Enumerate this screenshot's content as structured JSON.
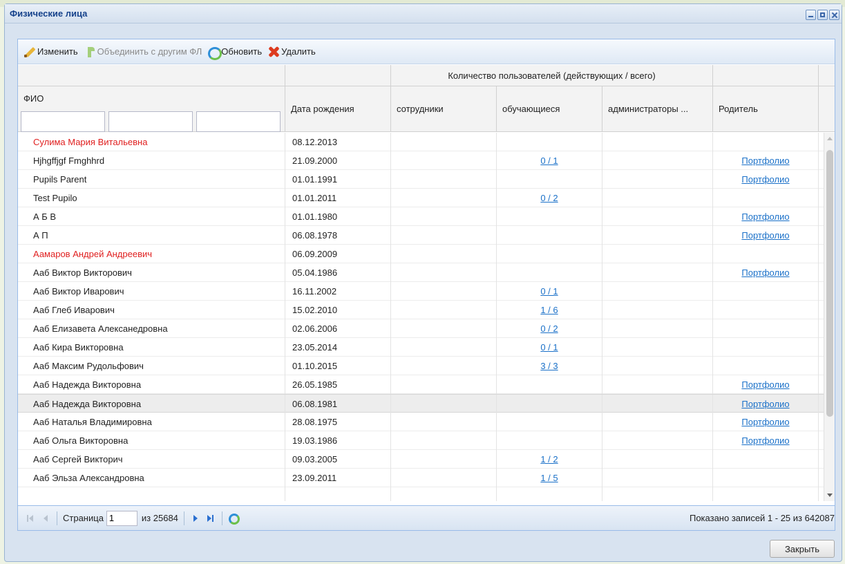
{
  "window": {
    "title": "Физические лица"
  },
  "toolbar": {
    "edit": "Изменить",
    "merge": "Объединить с другим ФЛ",
    "refresh": "Обновить",
    "delete": "Удалить"
  },
  "grid": {
    "group_header": "Количество пользователей (действующих / всего)",
    "columns": {
      "fio": "ФИО",
      "birth": "Дата рождения",
      "staff": "сотрудники",
      "students": "обучающиеся",
      "admins": "администраторы ...",
      "parent": "Родитель"
    },
    "rows": [
      {
        "name": "Сулима Мария Витальевна",
        "date": "08.12.2013",
        "students": "",
        "parent": "",
        "red": true
      },
      {
        "name": "Hjhgffjgf Fmghhrd",
        "date": "21.09.2000",
        "students": "0 / 1",
        "parent": "Портфолио"
      },
      {
        "name": "Pupils Parent",
        "date": "01.01.1991",
        "students": "",
        "parent": "Портфолио"
      },
      {
        "name": "Test Pupilo",
        "date": "01.01.2011",
        "students": "0 / 2",
        "parent": ""
      },
      {
        "name": "А Б В",
        "date": "01.01.1980",
        "students": "",
        "parent": "Портфолио"
      },
      {
        "name": "А П",
        "date": "06.08.1978",
        "students": "",
        "parent": "Портфолио"
      },
      {
        "name": "Аамаров Андрей Андреевич",
        "date": "06.09.2009",
        "students": "",
        "parent": "",
        "red": true
      },
      {
        "name": "Ааб Виктор Викторович",
        "date": "05.04.1986",
        "students": "",
        "parent": "Портфолио"
      },
      {
        "name": "Ааб Виктор Иварович",
        "date": "16.11.2002",
        "students": "0 / 1",
        "parent": ""
      },
      {
        "name": "Ааб Глеб Иварович",
        "date": "15.02.2010",
        "students": "1 / 6",
        "parent": ""
      },
      {
        "name": "Ааб Елизавета Алексанедровна",
        "date": "02.06.2006",
        "students": "0 / 2",
        "parent": ""
      },
      {
        "name": "Ааб Кира Викторовна",
        "date": "23.05.2014",
        "students": "0 / 1",
        "parent": ""
      },
      {
        "name": "Ааб Максим Рудольфович",
        "date": "01.10.2015",
        "students": "3 / 3",
        "parent": ""
      },
      {
        "name": "Ааб Надежда Викторовна",
        "date": "26.05.1985",
        "students": "",
        "parent": "Портфолио"
      },
      {
        "name": "Ааб Надежда Викторовна",
        "date": "06.08.1981",
        "students": "",
        "parent": "Портфолио",
        "selected": true
      },
      {
        "name": "Ааб Наталья Владимировна",
        "date": "28.08.1975",
        "students": "",
        "parent": "Портфолио"
      },
      {
        "name": "Ааб Ольга Викторовна",
        "date": "19.03.1986",
        "students": "",
        "parent": "Портфолио"
      },
      {
        "name": "Ааб Сергей Викторич",
        "date": "09.03.2005",
        "students": "1 / 2",
        "parent": ""
      },
      {
        "name": "Ааб Эльза Александровна",
        "date": "23.09.2011",
        "students": "1 / 5",
        "parent": ""
      },
      {
        "name": "",
        "date": "",
        "students": "",
        "parent": ""
      }
    ]
  },
  "pager": {
    "page_label": "Страница",
    "page_value": "1",
    "of_label": "из 25684",
    "info": "Показано записей 1 - 25 из 642087"
  },
  "footer": {
    "close": "Закрыть"
  },
  "colors": {
    "accent": "#15428b",
    "link": "#1a70c8",
    "red_name": "#e02020"
  }
}
